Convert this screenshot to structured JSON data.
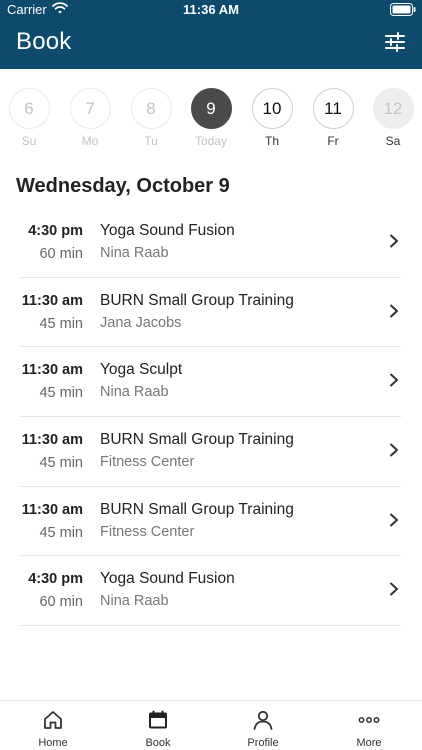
{
  "status_bar": {
    "carrier": "Carrier",
    "time": "11:36 AM"
  },
  "header": {
    "title": "Book",
    "filter_icon": "sliders-icon"
  },
  "week": [
    {
      "number": "6",
      "label": "Su",
      "state": "past"
    },
    {
      "number": "7",
      "label": "Mo",
      "state": "past"
    },
    {
      "number": "8",
      "label": "Tu",
      "state": "past"
    },
    {
      "number": "9",
      "label": "Today",
      "state": "today"
    },
    {
      "number": "10",
      "label": "Th",
      "state": "future"
    },
    {
      "number": "11",
      "label": "Fr",
      "state": "future"
    },
    {
      "number": "12",
      "label": "Sa",
      "state": "disabled"
    }
  ],
  "date_heading": "Wednesday, October 9",
  "classes": [
    {
      "time": "4:30 pm",
      "duration": "60 min",
      "name": "Yoga Sound Fusion",
      "instructor": "Nina Raab"
    },
    {
      "time": "11:30 am",
      "duration": "45 min",
      "name": "BURN Small Group Training",
      "instructor": "Jana Jacobs"
    },
    {
      "time": "11:30 am",
      "duration": "45 min",
      "name": "Yoga Sculpt",
      "instructor": "Nina Raab"
    },
    {
      "time": "11:30 am",
      "duration": "45 min",
      "name": "BURN Small Group Training",
      "instructor": "Fitness Center"
    },
    {
      "time": "11:30 am",
      "duration": "45 min",
      "name": "BURN Small Group Training",
      "instructor": "Fitness Center"
    },
    {
      "time": "4:30 pm",
      "duration": "60 min",
      "name": "Yoga Sound Fusion",
      "instructor": "Nina Raab"
    }
  ],
  "tab_bar": {
    "items": [
      {
        "label": "Home",
        "icon": "home-icon"
      },
      {
        "label": "Book",
        "icon": "calendar-icon",
        "active": true
      },
      {
        "label": "Profile",
        "icon": "person-icon"
      },
      {
        "label": "More",
        "icon": "more-dots-icon"
      }
    ]
  },
  "colors": {
    "header_bg": "#0d4a6b",
    "today_circle": "#4a4a4a",
    "divider": "#e4e4e4"
  }
}
